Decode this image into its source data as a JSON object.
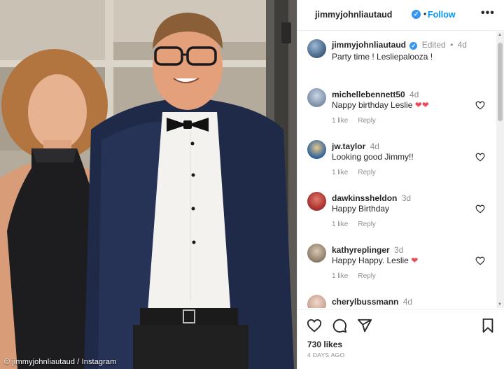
{
  "photo": {
    "credit": "© jimmyjohnliautaud / Instagram"
  },
  "header": {
    "username": "jimmyjohnliautaud",
    "verified_icon": "verified-badge-icon",
    "separator": "•",
    "follow_label": "Follow",
    "more_label": "•••"
  },
  "caption": {
    "username": "jimmyjohnliautaud",
    "edited": "Edited",
    "separator": "•",
    "time": "4d",
    "text": "Party time ! Lesliepalooza !"
  },
  "comments": [
    {
      "username": "michellebennett50",
      "time": "4d",
      "text": "Nappy birthday Leslie",
      "emoji": "❤❤",
      "likes": "1 like",
      "reply": "Reply"
    },
    {
      "username": "jw.taylor",
      "time": "4d",
      "text": "Looking good Jimmy!!",
      "emoji": "",
      "likes": "1 like",
      "reply": "Reply"
    },
    {
      "username": "dawkinssheldon",
      "time": "3d",
      "text": "Happy Birthday",
      "emoji": "",
      "likes": "1 like",
      "reply": "Reply"
    },
    {
      "username": "kathyreplinger",
      "time": "3d",
      "text": "Happy Happy. Leslie",
      "emoji": "❤",
      "likes": "1 like",
      "reply": "Reply"
    },
    {
      "username": "cherylbussmann",
      "time": "4d",
      "text": "",
      "emoji": "",
      "likes": "",
      "reply": ""
    }
  ],
  "footer": {
    "likes": "730 likes",
    "date": "4 DAYS AGO"
  },
  "colors": {
    "link_blue": "#0095f6",
    "verified_blue": "#3897f0",
    "heart_red": "#ed4956",
    "muted_text": "#8e8e8e"
  }
}
